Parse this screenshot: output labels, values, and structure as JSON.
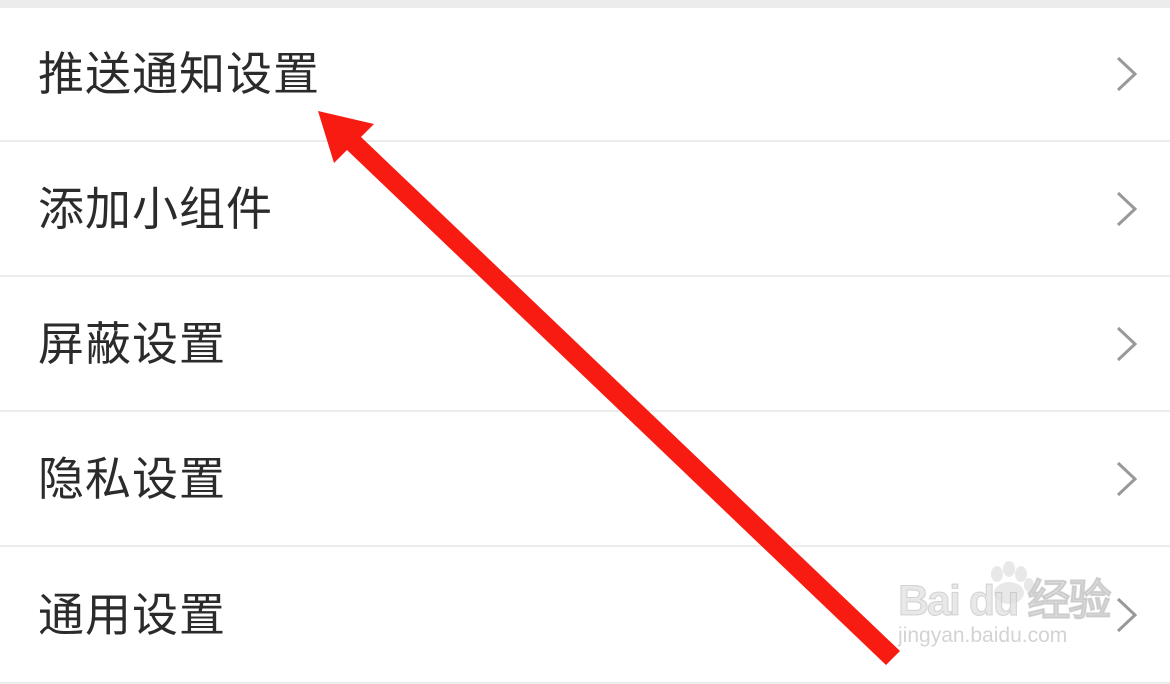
{
  "settings": {
    "items": [
      {
        "label": "推送通知设置"
      },
      {
        "label": "添加小组件"
      },
      {
        "label": "屏蔽设置"
      },
      {
        "label": "隐私设置"
      },
      {
        "label": "通用设置"
      }
    ]
  },
  "watermark": {
    "brand": "Bai du 经验",
    "url": "jingyan.baidu.com"
  },
  "colors": {
    "annotation": "#f71b12",
    "text": "#2b2b2b",
    "divider": "#ececec",
    "chevron": "#999999"
  }
}
